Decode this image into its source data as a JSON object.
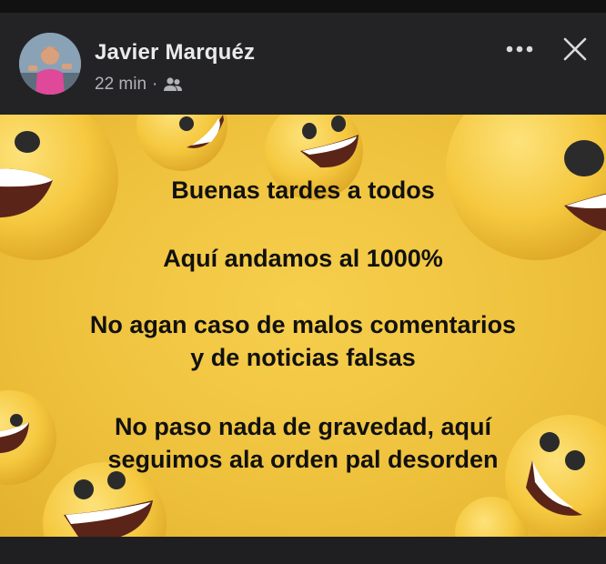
{
  "post": {
    "author": "Javier Marquéz",
    "time": "22 min",
    "separator": "·",
    "audience_icon": "friends-icon",
    "more_icon": "more-horizontal-icon",
    "close_icon": "close-icon"
  },
  "image": {
    "background_color": "#efc23d",
    "lines": [
      "Buenas tardes a todos",
      "Aquí andamos al 1000%",
      "No agan caso de malos comentarios",
      "y de noticias falsas",
      "No paso nada de gravedad, aquí",
      "seguimos ala orden pal desorden"
    ]
  }
}
